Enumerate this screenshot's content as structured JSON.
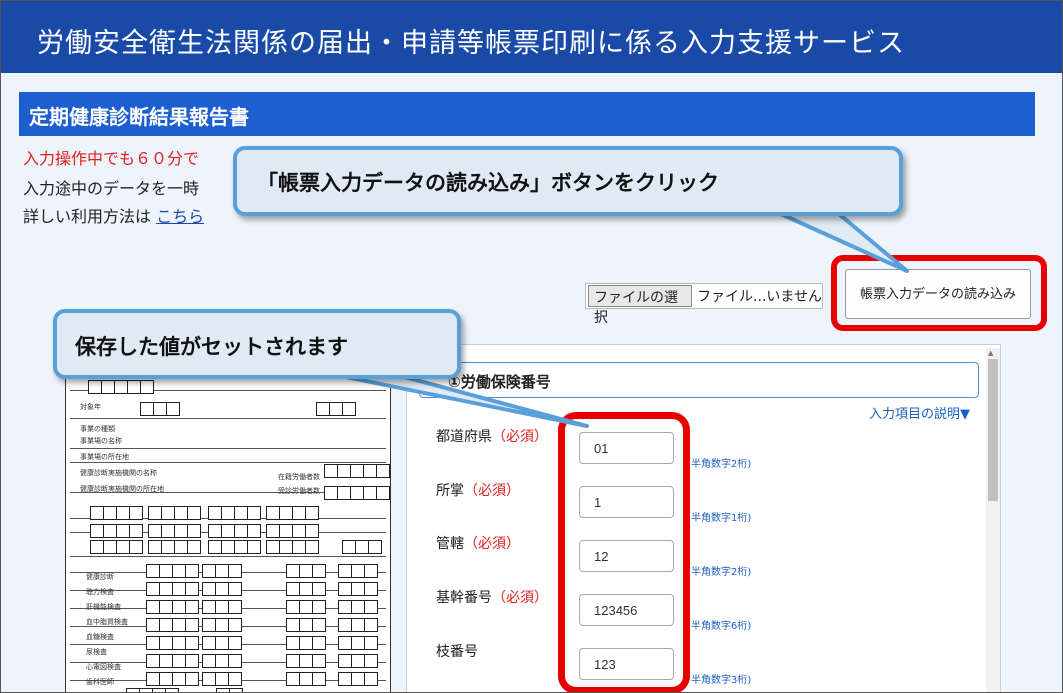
{
  "header": {
    "title": "労働安全衛生法関係の届出・申請等帳票印刷に係る入力支援サービス"
  },
  "section": {
    "title": "定期健康診断結果報告書"
  },
  "notices": {
    "warning": "入力操作中でも６０分で",
    "info": "入力途中のデータを一時",
    "detail_prefix": "詳しい利用方法は",
    "detail_link": "こちら"
  },
  "file_picker": {
    "button_label": "ファイルの選択",
    "status": "ファイル...いません"
  },
  "load_button": {
    "label": "帳票入力データの読み込み"
  },
  "callouts": {
    "load": "「帳票入力データの読み込み」ボタンをクリック",
    "saved": "保存した値がセットされます"
  },
  "panel": {
    "heading": "①労働保険番号",
    "explain_link": "入力項目の説明▼"
  },
  "fields": [
    {
      "label": "都道府県",
      "required": "（必須）",
      "value": "01",
      "hint": "半角数字2桁)"
    },
    {
      "label": "所掌",
      "required": "（必須）",
      "value": "1",
      "hint": "半角数字1桁)"
    },
    {
      "label": "管轄",
      "required": "（必須）",
      "value": "12",
      "hint": "半角数字2桁)"
    },
    {
      "label": "基幹番号",
      "required": "（必須）",
      "value": "123456",
      "hint": "半角数字6桁)"
    },
    {
      "label": "枝番号",
      "required": "",
      "value": "123",
      "hint": "半角数字3桁)"
    }
  ],
  "colors": {
    "header_blue": "#1a4aa8",
    "section_blue": "#1e5fcf",
    "highlight_red": "#e60000",
    "callout_border": "#5aa0d8"
  },
  "form_preview": {
    "labels": [
      "対象年",
      "事業の種類",
      "事業場の名称",
      "事業場の所在地",
      "健康診断実施機関の名称",
      "健康診断実施機関の所在地",
      "在籍労働者数",
      "受診労働者数",
      "健康診断",
      "聴力検査",
      "肝機能検査",
      "血中脂質検査",
      "血糖検査",
      "尿検査",
      "心電図検査",
      "歯科医師"
    ]
  }
}
